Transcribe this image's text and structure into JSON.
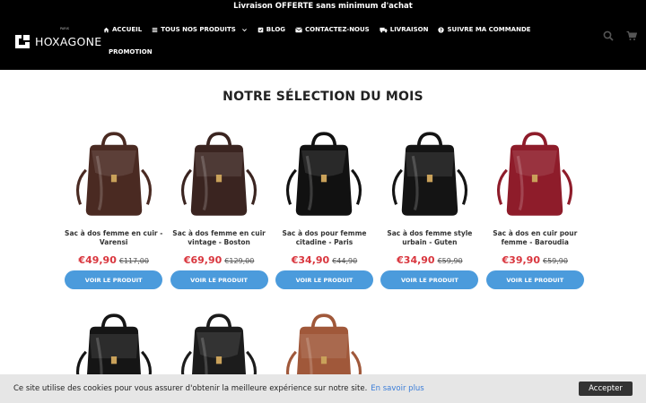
{
  "topbar": {
    "text": "Livraison OFFERTE sans minimum d'achat"
  },
  "logo": {
    "text": "HOXAGONE",
    "sub": "PARIS"
  },
  "nav": {
    "items": [
      {
        "label": "ACCUEIL",
        "icon": "home-icon"
      },
      {
        "label": "TOUS NOS PRODUITS",
        "icon": "list-icon",
        "dropdown": true
      },
      {
        "label": "BLOG",
        "icon": "check-square-icon"
      },
      {
        "label": "CONTACTEZ-NOUS",
        "icon": "envelope-icon"
      },
      {
        "label": "LIVRAISON",
        "icon": "truck-icon"
      },
      {
        "label": "SUIVRE MA COMMANDE",
        "icon": "question-circle-icon"
      }
    ],
    "promo": "PROMOTION"
  },
  "section": {
    "title": "NOTRE SÉLECTION DU MOIS"
  },
  "products": [
    {
      "name": "Sac à dos femme en cuir - Varensi",
      "price": "€49,90",
      "old": "€117,00",
      "btn": "VOIR LE PRODUIT",
      "color": "#4a2a22"
    },
    {
      "name": "Sac à dos femme en cuir vintage - Boston",
      "price": "€69,90",
      "old": "€129,00",
      "btn": "VOIR LE PRODUIT",
      "color": "#3a2420"
    },
    {
      "name": "Sac à dos pour femme citadine - Paris",
      "price": "€34,90",
      "old": "€44,90",
      "btn": "VOIR LE PRODUIT",
      "color": "#111111"
    },
    {
      "name": "Sac à dos femme style urbain - Guten",
      "price": "€34,90",
      "old": "€59,90",
      "btn": "VOIR LE PRODUIT",
      "color": "#141414"
    },
    {
      "name": "Sac à dos en cuir pour femme - Baroudia",
      "price": "€39,90",
      "old": "€59,90",
      "btn": "VOIR LE PRODUIT",
      "color": "#8e1c2a"
    }
  ],
  "products_row2": [
    {
      "color": "#151515"
    },
    {
      "color": "#1c1c1c"
    },
    {
      "color": "#a0583a"
    }
  ],
  "cookie": {
    "text": "Ce site utilise des cookies pour vous assurer d'obtenir la meilleure expérience sur notre site.",
    "link": "En savoir plus",
    "accept": "Accepter"
  }
}
